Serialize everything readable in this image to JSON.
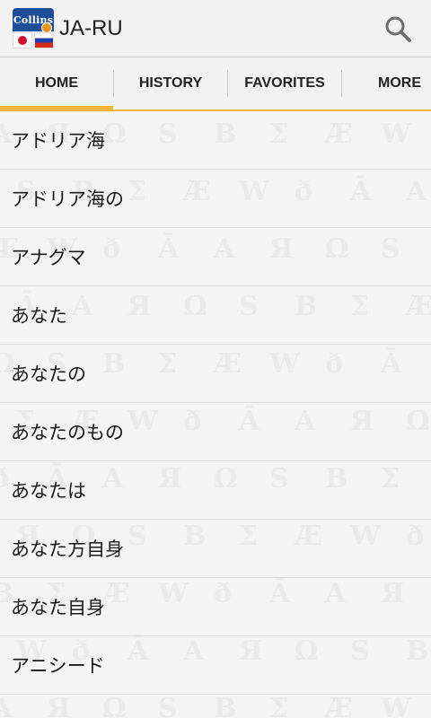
{
  "header": {
    "logo_text": "Collins",
    "title": "JA-RU",
    "search_icon": "magnifier-icon"
  },
  "tabs": [
    {
      "label": "HOME",
      "active": true
    },
    {
      "label": "HISTORY",
      "active": false
    },
    {
      "label": "FAVORITES",
      "active": false
    },
    {
      "label": "MORE",
      "active": false
    }
  ],
  "colors": {
    "accent": "#f2b43c",
    "logo_blue": "#1d4e9a"
  },
  "list": {
    "items": [
      "アドリア海",
      "アドリア海の",
      "アナグマ",
      "あなた",
      "あなたの",
      "あなたのもの",
      "あなたは",
      "あなた方自身",
      "あなた自身",
      "アニシード"
    ]
  }
}
